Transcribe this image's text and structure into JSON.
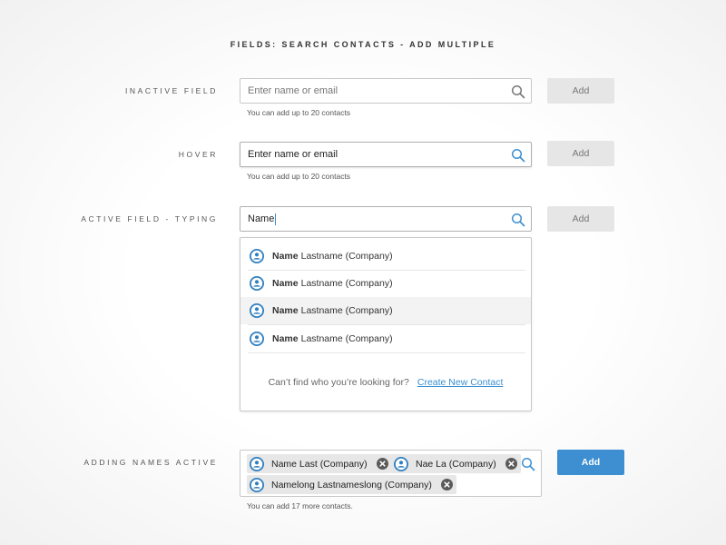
{
  "page": {
    "title": "FIELDS: SEARCH CONTACTS - ADD MULTIPLE"
  },
  "colors": {
    "accent": "#3d8fd1",
    "disabled_button": "#e6e6e6",
    "chip": "#e7e7e7"
  },
  "rows": {
    "inactive": {
      "label": "INACTIVE  FIELD",
      "placeholder": "Enter name or email",
      "helper": "You can add up to 20 contacts",
      "button": "Add",
      "icon": "search-icon"
    },
    "hover": {
      "label": "HOVER",
      "placeholder": "Enter name or email",
      "helper": "You can add up to 20 contacts",
      "button": "Add",
      "icon": "search-icon"
    },
    "active": {
      "label": "ACTIVE  FIELD - TYPING",
      "value": "Name",
      "button": "Add",
      "icon": "search-icon",
      "dropdown": {
        "items": [
          {
            "bold": "Name",
            "rest": "Lastname (Company)"
          },
          {
            "bold": "Name",
            "rest": "Lastname (Company)"
          },
          {
            "bold": "Name",
            "rest": "Lastname (Company)",
            "highlighted": true
          },
          {
            "bold": "Name",
            "rest": "Lastname (Company)"
          }
        ],
        "footer_text": "Can’t find who you’re looking for?",
        "footer_link": "Create New Contact"
      }
    },
    "adding": {
      "label": "ADDING NAMES ACTIVE",
      "chips": [
        {
          "label": "Name Last (Company)"
        },
        {
          "label": "Nae La (Company)"
        },
        {
          "label": "Namelong Lastnameslong (Company)"
        }
      ],
      "helper": "You can add 17 more  contacts.",
      "button": "Add",
      "icon": "search-icon"
    }
  }
}
